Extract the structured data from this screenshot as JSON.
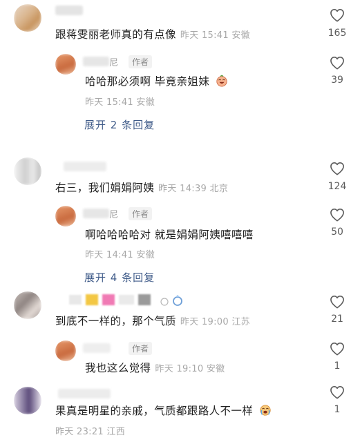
{
  "comments": [
    {
      "text": "跟蒋雯丽老师真的有点像",
      "meta": "昨天 15:41 安徽",
      "likes": "165",
      "replies": [
        {
          "name_fragment": "尼",
          "author_tag": "作者",
          "text": "哈哈那必须啊 毕竟亲姐妹",
          "emoji": "laughing-face-emoji",
          "meta": "昨天 15:41 安徽",
          "likes": "39"
        }
      ],
      "expand_label": "展开 2 条回复"
    },
    {
      "text": "右三，我们娟娟阿姨",
      "meta": "昨天 14:39 北京",
      "likes": "124",
      "replies": [
        {
          "name_fragment": "尼",
          "author_tag": "作者",
          "text": "啊哈哈哈哈对 就是娟娟阿姨嘻嘻嘻",
          "meta": "昨天 14:41 安徽",
          "likes": "50"
        }
      ],
      "expand_label": "展开 4 条回复"
    },
    {
      "text": "到底不一样的，那个气质",
      "meta": "昨天 19:00 江苏",
      "likes": "21",
      "replies": [
        {
          "author_tag": "作者",
          "text": "我也这么觉得",
          "meta": "昨天 19:10 安徽",
          "likes": "1"
        }
      ]
    },
    {
      "text": "果真是明星的亲戚，气质都跟路人不一样",
      "emoji": "crying-face-emoji",
      "meta": "昨天 23:21 江西",
      "likes": "1"
    }
  ],
  "colors": {
    "text": "#1f1f1f",
    "meta": "#a8a8a8",
    "link": "#3e5a88",
    "icon": "#5c5c5c"
  }
}
